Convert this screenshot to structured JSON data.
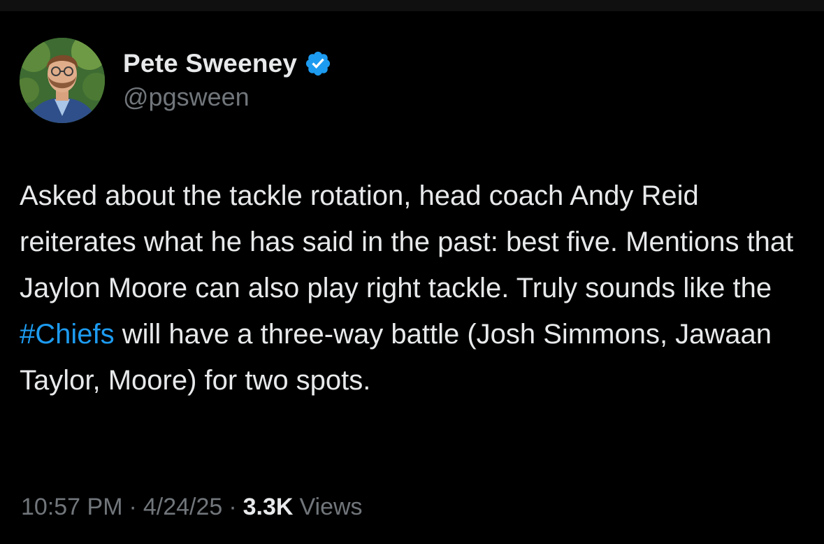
{
  "author": {
    "display_name": "Pete Sweeney",
    "handle": "@pgsween",
    "verified": true,
    "avatar_icon": "profile-photo"
  },
  "tweet": {
    "text_before_hashtag": "Asked about the tackle rotation, head coach Andy Reid reiterates what he has said in the past: best five. Mentions that Jaylon Moore can also play right tackle. Truly sounds like the ",
    "hashtag": "#Chiefs",
    "text_after_hashtag": " will have a three-way battle (Josh Simmons, Jawaan Taylor, Moore) for two spots."
  },
  "meta": {
    "time": "10:57 PM",
    "separator": "·",
    "date": "4/24/25",
    "views_count": "3.3K",
    "views_label": "Views"
  },
  "colors": {
    "background": "#000000",
    "primary_text": "#e7e9ea",
    "secondary_text": "#71767b",
    "link": "#1d9bf0",
    "verified_badge": "#1d9bf0"
  }
}
